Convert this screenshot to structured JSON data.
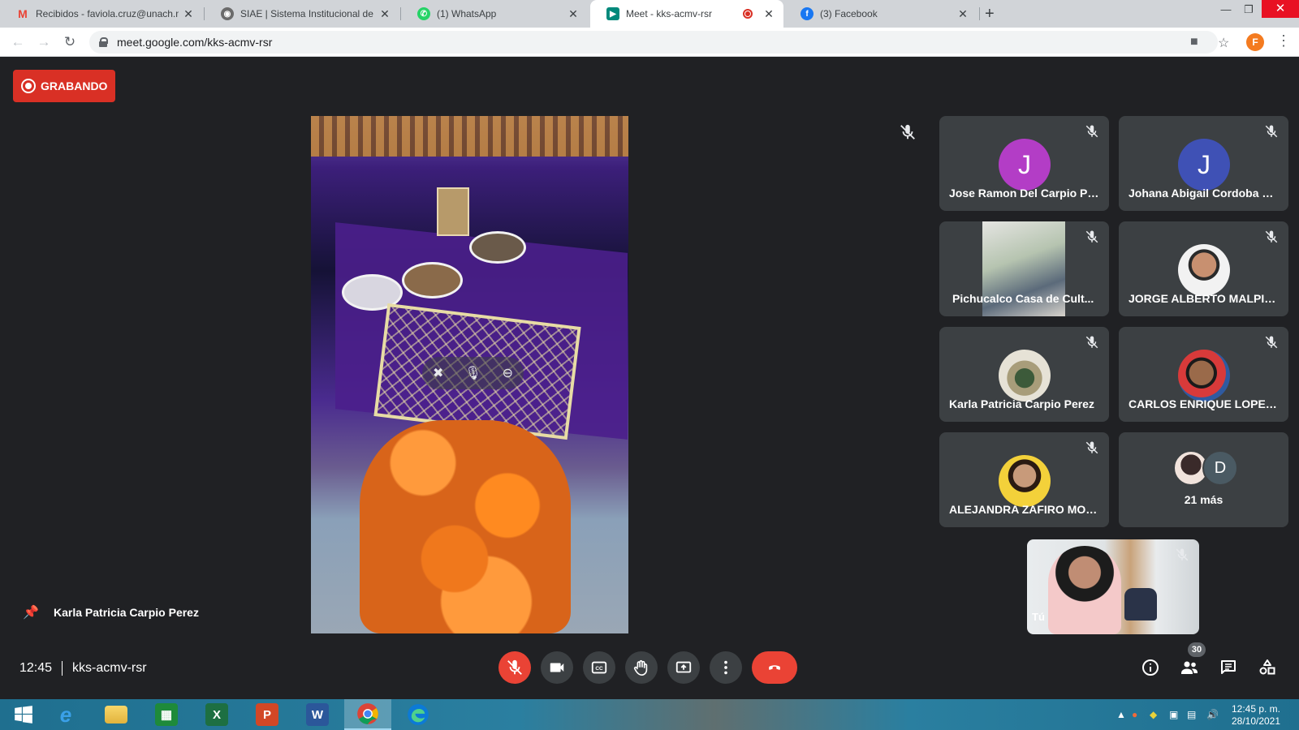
{
  "browser": {
    "tabs": [
      {
        "title": "Recibidos - faviola.cruz@unach.m",
        "icon": "gmail-icon",
        "color": "#ea4335"
      },
      {
        "title": "SIAE | Sistema Institucional de Ad",
        "icon": "siae-icon",
        "color": "#4a4a4a"
      },
      {
        "title": "(1) WhatsApp",
        "icon": "whatsapp-icon",
        "color": "#25d366"
      },
      {
        "title": "Meet - kks-acmv-rsr",
        "icon": "meet-icon",
        "color": "#00897b"
      },
      {
        "title": "(3) Facebook",
        "icon": "facebook-icon",
        "color": "#1877f2"
      }
    ],
    "url": "meet.google.com/kks-acmv-rsr",
    "profile_initial": "F"
  },
  "meet": {
    "recording_label": "GRABANDO",
    "pinned_name": "Karla Patricia Carpio Perez",
    "participants": [
      {
        "name": "Jose Ramon Del Carpio Pe...",
        "initial": "J",
        "avatar_color": "#b33dc6"
      },
      {
        "name": "Johana Abigail Cordoba H...",
        "initial": "J",
        "avatar_color": "#3f51b5"
      },
      {
        "name": "Pichucalco Casa de Cult..."
      },
      {
        "name": "JORGE ALBERTO MALPIC..."
      },
      {
        "name": "Karla Patricia Carpio Perez"
      },
      {
        "name": "CARLOS ENRIQUE LOPEZ ..."
      },
      {
        "name": "ALEJANDRA ZAFIRO MOR..."
      }
    ],
    "more": {
      "initial": "D",
      "label": "21 más"
    },
    "self_label": "Tú",
    "time": "12:45",
    "meeting_code": "kks-acmv-rsr",
    "participant_count": "30"
  },
  "taskbar": {
    "clock_time": "12:45 p. m.",
    "clock_date": "28/10/2021",
    "apps": [
      "windows-start-icon",
      "internet-explorer-icon",
      "file-explorer-icon",
      "store-icon",
      "excel-icon",
      "powerpoint-icon",
      "word-icon",
      "chrome-icon",
      "edge-icon"
    ]
  }
}
